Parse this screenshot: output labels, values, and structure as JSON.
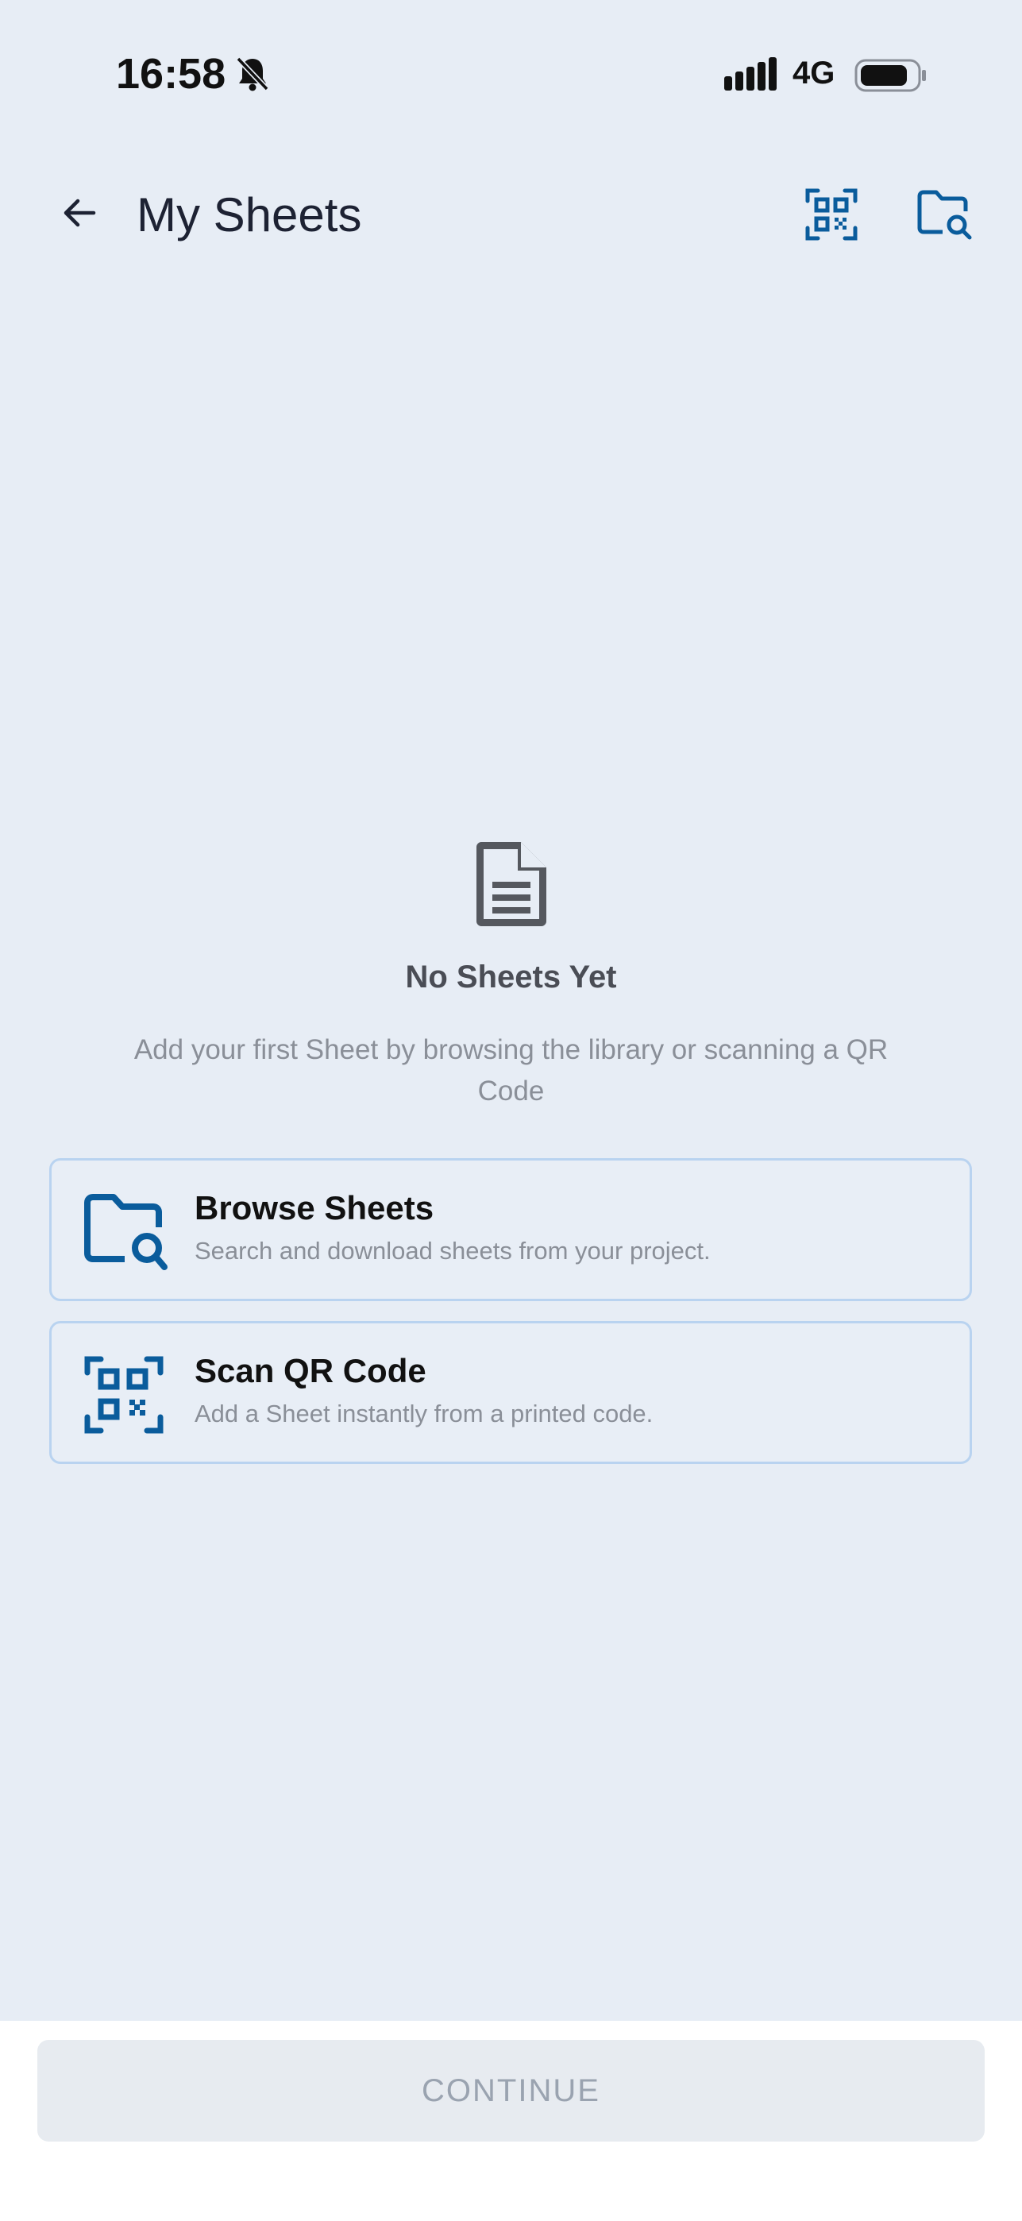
{
  "status_bar": {
    "time": "16:58",
    "network": "4G",
    "icons": [
      "bell-muted-icon",
      "signal-icon",
      "battery-icon"
    ]
  },
  "header": {
    "title": "My Sheets",
    "icons": [
      "arrow-left-icon",
      "qr-code-icon",
      "folder-search-icon"
    ]
  },
  "empty_state": {
    "icon": "document-icon",
    "title": "No Sheets Yet",
    "description": "Add your first Sheet by browsing the library or scanning a QR Code"
  },
  "actions": [
    {
      "title": "Browse Sheets",
      "subtitle": "Search and download sheets from your project.",
      "icon": "folder-search-icon"
    },
    {
      "title": "Scan QR Code",
      "subtitle": "Add a Sheet instantly from a printed code.",
      "icon": "qr-code-icon"
    }
  ],
  "footer": {
    "continue_label": "CONTINUE"
  },
  "colors": {
    "background": "#e7edf5",
    "accent": "#0a5c9c",
    "card_border": "#b9d3f0",
    "disabled_text": "#9aa3b0"
  }
}
